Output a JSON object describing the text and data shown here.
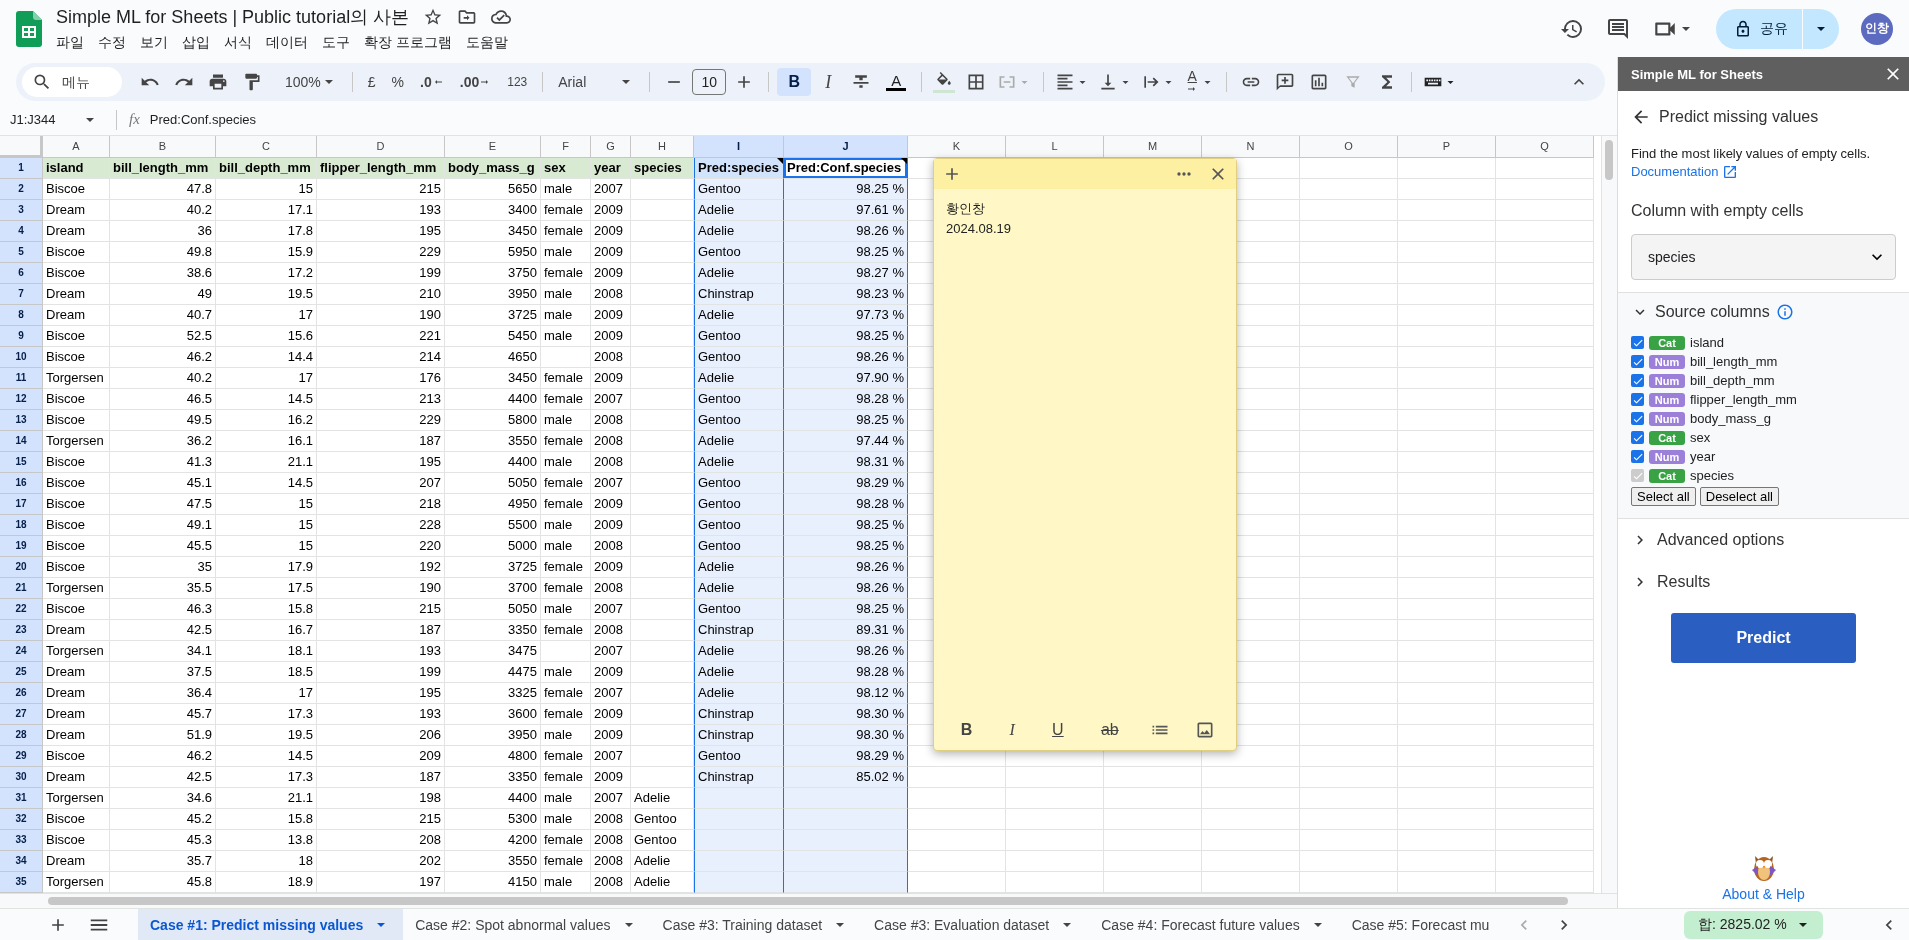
{
  "header": {
    "title": "Simple ML for Sheets | Public tutorial의 사본",
    "menu": [
      "파일",
      "수정",
      "보기",
      "삽입",
      "서식",
      "데이터",
      "도구",
      "확장 프로그램",
      "도움말"
    ],
    "share": "공유",
    "avatar": "인창"
  },
  "toolbar": {
    "search_placeholder": "메뉴",
    "zoom": "100%",
    "currency": "£",
    "percent": "%",
    "decrease_decimals": ".0",
    "increase_decimals": ".00",
    "number_format": "123",
    "font": "Arial",
    "font_size": "10",
    "bold": {
      "label": "B",
      "on": true
    },
    "italic": {
      "label": "I",
      "on": false
    },
    "text_color": "A",
    "text_rotation": "A"
  },
  "formula_bar": {
    "name_box": "J1:J344",
    "fx": "fx",
    "formula": "Pred:Conf.species"
  },
  "sheet": {
    "columns": [
      {
        "letter": "A",
        "selected": false
      },
      {
        "letter": "B",
        "selected": false
      },
      {
        "letter": "C",
        "selected": false
      },
      {
        "letter": "D",
        "selected": false
      },
      {
        "letter": "E",
        "selected": false
      },
      {
        "letter": "F",
        "selected": false
      },
      {
        "letter": "G",
        "selected": false
      },
      {
        "letter": "H",
        "selected": false
      },
      {
        "letter": "I",
        "selected": true
      },
      {
        "letter": "J",
        "selected": true
      },
      {
        "letter": "K",
        "selected": false
      },
      {
        "letter": "L",
        "selected": false
      },
      {
        "letter": "M",
        "selected": false
      },
      {
        "letter": "N",
        "selected": false
      },
      {
        "letter": "O",
        "selected": false
      },
      {
        "letter": "P",
        "selected": false
      },
      {
        "letter": "Q",
        "selected": false
      }
    ],
    "header_row": {
      "number": "1",
      "selected": true,
      "cells": [
        {
          "text": "island",
          "note": false,
          "active": false
        },
        {
          "text": "bill_length_mm",
          "note": false,
          "active": false
        },
        {
          "text": "bill_depth_mm",
          "note": false,
          "active": false
        },
        {
          "text": "flipper_length_mm",
          "note": false,
          "active": false
        },
        {
          "text": "body_mass_g",
          "note": false,
          "active": false
        },
        {
          "text": "sex",
          "note": false,
          "active": false
        },
        {
          "text": "year",
          "note": false,
          "active": false
        },
        {
          "text": "species",
          "note": false,
          "active": false
        },
        {
          "text": "Pred:species",
          "note": true,
          "active": false
        },
        {
          "text": "Pred:Conf.species",
          "note": true,
          "active": true
        }
      ]
    },
    "rows": [
      {
        "number": "2",
        "selected": true,
        "cells": [
          "Biscoe",
          "47.8",
          "15",
          "215",
          "5650",
          "male",
          "2007",
          null,
          "Gentoo",
          "98.25 %"
        ]
      },
      {
        "number": "3",
        "selected": true,
        "cells": [
          "Dream",
          "40.2",
          "17.1",
          "193",
          "3400",
          "female",
          "2009",
          null,
          "Adelie",
          "97.61 %"
        ]
      },
      {
        "number": "4",
        "selected": true,
        "cells": [
          "Dream",
          "36",
          "17.8",
          "195",
          "3450",
          "female",
          "2009",
          null,
          "Adelie",
          "98.26 %"
        ]
      },
      {
        "number": "5",
        "selected": true,
        "cells": [
          "Biscoe",
          "49.8",
          "15.9",
          "229",
          "5950",
          "male",
          "2009",
          null,
          "Gentoo",
          "98.25 %"
        ]
      },
      {
        "number": "6",
        "selected": true,
        "cells": [
          "Biscoe",
          "38.6",
          "17.2",
          "199",
          "3750",
          "female",
          "2009",
          null,
          "Adelie",
          "98.27 %"
        ]
      },
      {
        "number": "7",
        "selected": true,
        "cells": [
          "Dream",
          "49",
          "19.5",
          "210",
          "3950",
          "male",
          "2008",
          null,
          "Chinstrap",
          "98.23 %"
        ]
      },
      {
        "number": "8",
        "selected": true,
        "cells": [
          "Dream",
          "40.7",
          "17",
          "190",
          "3725",
          "male",
          "2009",
          null,
          "Adelie",
          "97.73 %"
        ]
      },
      {
        "number": "9",
        "selected": true,
        "cells": [
          "Biscoe",
          "52.5",
          "15.6",
          "221",
          "5450",
          "male",
          "2009",
          null,
          "Gentoo",
          "98.25 %"
        ]
      },
      {
        "number": "10",
        "selected": true,
        "cells": [
          "Biscoe",
          "46.2",
          "14.4",
          "214",
          "4650",
          null,
          "2008",
          null,
          "Gentoo",
          "98.26 %"
        ]
      },
      {
        "number": "11",
        "selected": true,
        "cells": [
          "Torgersen",
          "40.2",
          "17",
          "176",
          "3450",
          "female",
          "2009",
          null,
          "Adelie",
          "97.90 %"
        ]
      },
      {
        "number": "12",
        "selected": true,
        "cells": [
          "Biscoe",
          "46.5",
          "14.5",
          "213",
          "4400",
          "female",
          "2007",
          null,
          "Gentoo",
          "98.28 %"
        ]
      },
      {
        "number": "13",
        "selected": true,
        "cells": [
          "Biscoe",
          "49.5",
          "16.2",
          "229",
          "5800",
          "male",
          "2008",
          null,
          "Gentoo",
          "98.25 %"
        ]
      },
      {
        "number": "14",
        "selected": true,
        "cells": [
          "Torgersen",
          "36.2",
          "16.1",
          "187",
          "3550",
          "female",
          "2008",
          null,
          "Adelie",
          "97.44 %"
        ]
      },
      {
        "number": "15",
        "selected": true,
        "cells": [
          "Biscoe",
          "41.3",
          "21.1",
          "195",
          "4400",
          "male",
          "2008",
          null,
          "Adelie",
          "98.31 %"
        ]
      },
      {
        "number": "16",
        "selected": true,
        "cells": [
          "Biscoe",
          "45.1",
          "14.5",
          "207",
          "5050",
          "female",
          "2007",
          null,
          "Gentoo",
          "98.29 %"
        ]
      },
      {
        "number": "17",
        "selected": true,
        "cells": [
          "Biscoe",
          "47.5",
          "15",
          "218",
          "4950",
          "female",
          "2009",
          null,
          "Gentoo",
          "98.28 %"
        ]
      },
      {
        "number": "18",
        "selected": true,
        "cells": [
          "Biscoe",
          "49.1",
          "15",
          "228",
          "5500",
          "male",
          "2009",
          null,
          "Gentoo",
          "98.25 %"
        ]
      },
      {
        "number": "19",
        "selected": true,
        "cells": [
          "Biscoe",
          "45.5",
          "15",
          "220",
          "5000",
          "male",
          "2008",
          null,
          "Gentoo",
          "98.25 %"
        ]
      },
      {
        "number": "20",
        "selected": true,
        "cells": [
          "Biscoe",
          "35",
          "17.9",
          "192",
          "3725",
          "female",
          "2009",
          null,
          "Adelie",
          "98.26 %"
        ]
      },
      {
        "number": "21",
        "selected": true,
        "cells": [
          "Torgersen",
          "35.5",
          "17.5",
          "190",
          "3700",
          "female",
          "2008",
          null,
          "Adelie",
          "98.26 %"
        ]
      },
      {
        "number": "22",
        "selected": true,
        "cells": [
          "Biscoe",
          "46.3",
          "15.8",
          "215",
          "5050",
          "male",
          "2007",
          null,
          "Gentoo",
          "98.25 %"
        ]
      },
      {
        "number": "23",
        "selected": true,
        "cells": [
          "Dream",
          "42.5",
          "16.7",
          "187",
          "3350",
          "female",
          "2008",
          null,
          "Chinstrap",
          "89.31 %"
        ]
      },
      {
        "number": "24",
        "selected": true,
        "cells": [
          "Torgersen",
          "34.1",
          "18.1",
          "193",
          "3475",
          null,
          "2007",
          null,
          "Adelie",
          "98.26 %"
        ]
      },
      {
        "number": "25",
        "selected": true,
        "cells": [
          "Dream",
          "37.5",
          "18.5",
          "199",
          "4475",
          "male",
          "2009",
          null,
          "Adelie",
          "98.28 %"
        ]
      },
      {
        "number": "26",
        "selected": true,
        "cells": [
          "Dream",
          "36.4",
          "17",
          "195",
          "3325",
          "female",
          "2007",
          null,
          "Adelie",
          "98.12 %"
        ]
      },
      {
        "number": "27",
        "selected": true,
        "cells": [
          "Dream",
          "45.7",
          "17.3",
          "193",
          "3600",
          "female",
          "2009",
          null,
          "Chinstrap",
          "98.30 %"
        ]
      },
      {
        "number": "28",
        "selected": true,
        "cells": [
          "Dream",
          "51.9",
          "19.5",
          "206",
          "3950",
          "male",
          "2009",
          null,
          "Chinstrap",
          "98.30 %"
        ]
      },
      {
        "number": "29",
        "selected": true,
        "cells": [
          "Biscoe",
          "46.2",
          "14.5",
          "209",
          "4800",
          "female",
          "2007",
          null,
          "Gentoo",
          "98.29 %"
        ]
      },
      {
        "number": "30",
        "selected": true,
        "cells": [
          "Dream",
          "42.5",
          "17.3",
          "187",
          "3350",
          "female",
          "2009",
          null,
          "Chinstrap",
          "85.02 %"
        ]
      },
      {
        "number": "31",
        "selected": true,
        "cells": [
          "Torgersen",
          "34.6",
          "21.1",
          "198",
          "4400",
          "male",
          "2007",
          "Adelie"
        ]
      },
      {
        "number": "32",
        "selected": true,
        "cells": [
          "Biscoe",
          "45.2",
          "15.8",
          "215",
          "5300",
          "male",
          "2008",
          "Gentoo"
        ]
      },
      {
        "number": "33",
        "selected": true,
        "cells": [
          "Biscoe",
          "45.3",
          "13.8",
          "208",
          "4200",
          "female",
          "2008",
          "Gentoo"
        ]
      },
      {
        "number": "34",
        "selected": true,
        "cells": [
          "Dream",
          "35.7",
          "18",
          "202",
          "3550",
          "female",
          "2008",
          "Adelie"
        ]
      },
      {
        "number": "35",
        "selected": true,
        "cells": [
          "Torgersen",
          "45.8",
          "18.9",
          "197",
          "4150",
          "male",
          "2008",
          "Adelie"
        ]
      }
    ]
  },
  "note": {
    "lines": [
      "황인창",
      "2024.08.19"
    ],
    "format": [
      "B",
      "I",
      "U",
      "ab"
    ]
  },
  "sidebar": {
    "title": "Simple ML for Sheets",
    "heading": "Predict missing values",
    "description": "Find the most likely values of empty cells.",
    "doc_link": "Documentation",
    "target_label": "Column with empty cells",
    "target_value": "species",
    "source_columns": {
      "title": "Source columns",
      "expanded": true,
      "items": [
        {
          "type": "Cat",
          "color": "#38a245",
          "name": "island",
          "checked": true,
          "disabled": false
        },
        {
          "type": "Num",
          "color": "#9c7fd8",
          "name": "bill_length_mm",
          "checked": true,
          "disabled": false
        },
        {
          "type": "Num",
          "color": "#9c7fd8",
          "name": "bill_depth_mm",
          "checked": true,
          "disabled": false
        },
        {
          "type": "Num",
          "color": "#9c7fd8",
          "name": "flipper_length_mm",
          "checked": true,
          "disabled": false
        },
        {
          "type": "Num",
          "color": "#9c7fd8",
          "name": "body_mass_g",
          "checked": true,
          "disabled": false
        },
        {
          "type": "Cat",
          "color": "#38a245",
          "name": "sex",
          "checked": true,
          "disabled": false
        },
        {
          "type": "Num",
          "color": "#9c7fd8",
          "name": "year",
          "checked": true,
          "disabled": false
        },
        {
          "type": "Cat",
          "color": "#38a245",
          "name": "species",
          "checked": true,
          "disabled": true
        }
      ]
    },
    "select_all": "Select all",
    "deselect_all": "Deselect all",
    "sections": [
      {
        "label": "Advanced options",
        "expanded": false
      },
      {
        "label": "Results",
        "expanded": false
      }
    ],
    "action": "Predict",
    "help": "About & Help"
  },
  "tabs": [
    {
      "label": "Case #1: Predict missing values",
      "selected": true,
      "dropdown": true
    },
    {
      "label": "Case #2: Spot abnormal values",
      "selected": false,
      "dropdown": true
    },
    {
      "label": "Case #3: Training dataset",
      "selected": false,
      "dropdown": true
    },
    {
      "label": "Case #3: Evaluation dataset",
      "selected": false,
      "dropdown": true
    },
    {
      "label": "Case #4: Forecast future values",
      "selected": false,
      "dropdown": true
    },
    {
      "label": "Case #5: Forecast mu",
      "selected": false,
      "dropdown": false
    }
  ],
  "sum": "합: 2825.02 %"
}
